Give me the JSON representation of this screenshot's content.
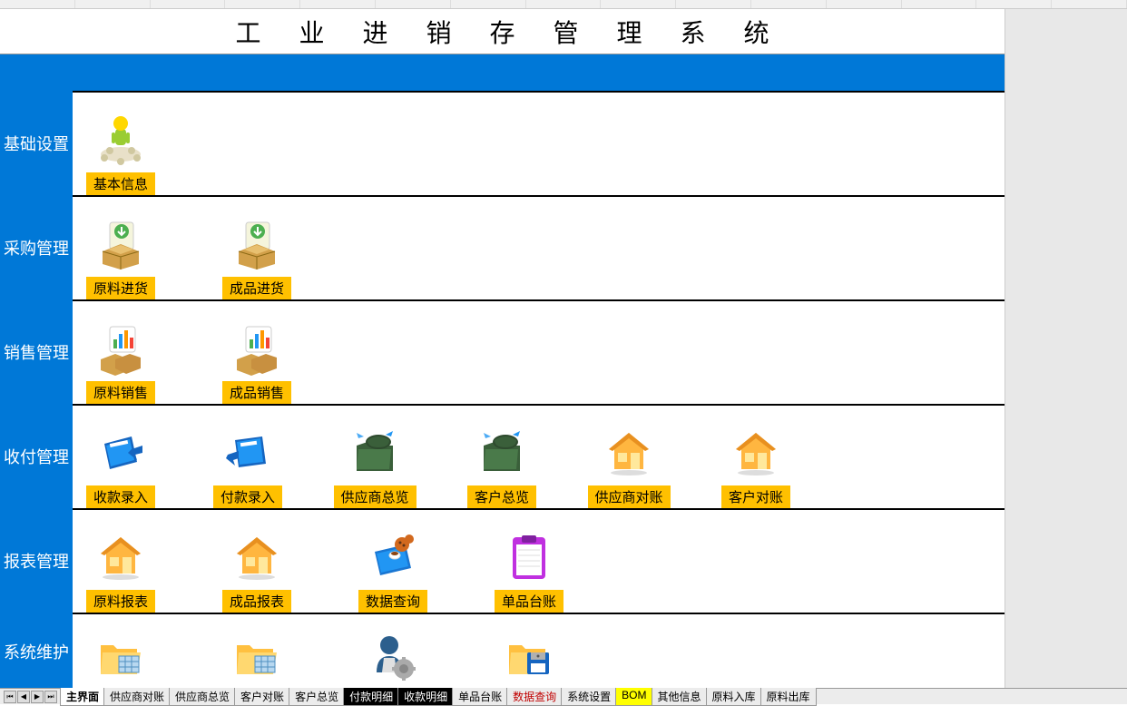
{
  "app_title": "工业进销存管理系统",
  "sections": [
    {
      "label": "基础设置",
      "items": [
        {
          "icon": "person-gold",
          "label": "基本信息"
        }
      ]
    },
    {
      "label": "采购管理",
      "items": [
        {
          "icon": "box-download",
          "label": "原料进货"
        },
        {
          "icon": "box-download",
          "label": "成品进货"
        }
      ]
    },
    {
      "label": "销售管理",
      "items": [
        {
          "icon": "box-chart",
          "label": "原料销售"
        },
        {
          "icon": "box-chart",
          "label": "成品销售"
        }
      ]
    },
    {
      "label": "收付管理",
      "items": [
        {
          "icon": "book-blue-in",
          "label": "收款录入"
        },
        {
          "icon": "book-blue-out",
          "label": "付款录入"
        },
        {
          "icon": "folder-phone",
          "label": "供应商总览"
        },
        {
          "icon": "folder-phone",
          "label": "客户总览"
        },
        {
          "icon": "house",
          "label": "供应商对账"
        },
        {
          "icon": "house",
          "label": "客户对账"
        }
      ]
    },
    {
      "label": "报表管理",
      "items": [
        {
          "icon": "house",
          "label": "原料报表"
        },
        {
          "icon": "house",
          "label": "成品报表"
        },
        {
          "icon": "book-cookies",
          "label": "数据查询"
        },
        {
          "icon": "clipboard",
          "label": "单品台账"
        }
      ]
    },
    {
      "label": "系统维护",
      "items": [
        {
          "icon": "folder-grid",
          "label": ""
        },
        {
          "icon": "folder-grid",
          "label": ""
        },
        {
          "icon": "person-gear",
          "label": ""
        },
        {
          "icon": "folder-disk",
          "label": ""
        }
      ]
    }
  ],
  "sheet_tabs": [
    {
      "name": "主界面",
      "style": "active"
    },
    {
      "name": "供应商对账",
      "style": ""
    },
    {
      "name": "供应商总览",
      "style": ""
    },
    {
      "name": "客户对账",
      "style": ""
    },
    {
      "name": "客户总览",
      "style": ""
    },
    {
      "name": "付款明细",
      "style": "black"
    },
    {
      "name": "收款明细",
      "style": "black"
    },
    {
      "name": "单品台账",
      "style": ""
    },
    {
      "name": "数据查询",
      "style": "red"
    },
    {
      "name": "系统设置",
      "style": ""
    },
    {
      "name": "BOM",
      "style": "yellow"
    },
    {
      "name": "其他信息",
      "style": ""
    },
    {
      "name": "原料入库",
      "style": ""
    },
    {
      "name": "原料出库",
      "style": ""
    }
  ]
}
